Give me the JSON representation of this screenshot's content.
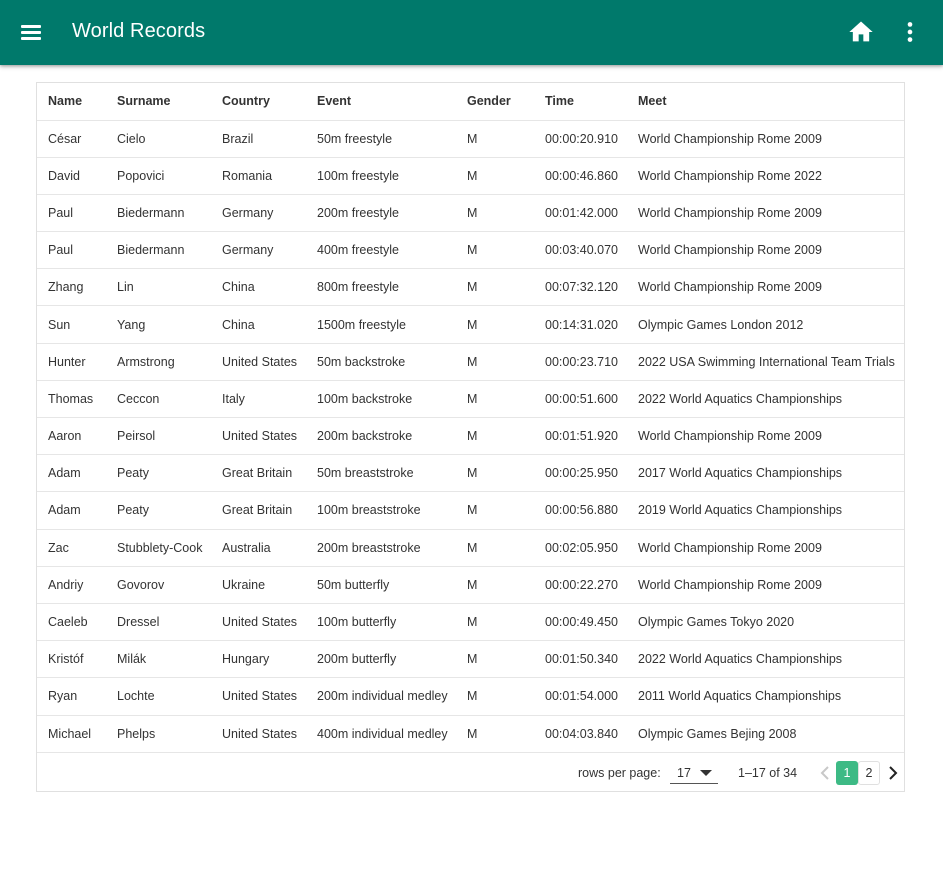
{
  "appbar": {
    "title": "World Records",
    "menu_icon": "menu-icon",
    "home_icon": "home-icon",
    "more_icon": "more-vert-icon",
    "background_color": "#00796b"
  },
  "table": {
    "headers": [
      "Name",
      "Surname",
      "Country",
      "Event",
      "Gender",
      "Time",
      "Meet"
    ],
    "rows": [
      [
        "César",
        "Cielo",
        "Brazil",
        "50m freestyle",
        "M",
        "00:00:20.910",
        "World Championship Rome 2009"
      ],
      [
        "David",
        "Popovici",
        "Romania",
        "100m freestyle",
        "M",
        "00:00:46.860",
        "World Championship Rome 2022"
      ],
      [
        "Paul",
        "Biedermann",
        "Germany",
        "200m freestyle",
        "M",
        "00:01:42.000",
        "World Championship Rome 2009"
      ],
      [
        "Paul",
        "Biedermann",
        "Germany",
        "400m freestyle",
        "M",
        "00:03:40.070",
        "World Championship Rome 2009"
      ],
      [
        "Zhang",
        "Lin",
        "China",
        "800m freestyle",
        "M",
        "00:07:32.120",
        "World Championship Rome 2009"
      ],
      [
        "Sun",
        "Yang",
        "China",
        "1500m freestyle",
        "M",
        "00:14:31.020",
        "Olympic Games London 2012"
      ],
      [
        "Hunter",
        "Armstrong",
        "United States",
        "50m backstroke",
        "M",
        "00:00:23.710",
        "2022 USA Swimming International Team Trials"
      ],
      [
        "Thomas",
        "Ceccon",
        "Italy",
        "100m backstroke",
        "M",
        "00:00:51.600",
        "2022 World Aquatics Championships"
      ],
      [
        "Aaron",
        "Peirsol",
        "United States",
        "200m backstroke",
        "M",
        "00:01:51.920",
        "World Championship Rome 2009"
      ],
      [
        "Adam",
        "Peaty",
        "Great Britain",
        "50m breaststroke",
        "M",
        "00:00:25.950",
        "2017 World Aquatics Championships"
      ],
      [
        "Adam",
        "Peaty",
        "Great Britain",
        "100m breaststroke",
        "M",
        "00:00:56.880",
        "2019 World Aquatics Championships"
      ],
      [
        "Zac",
        "Stubblety-Cook",
        "Australia",
        "200m breaststroke",
        "M",
        "00:02:05.950",
        "World Championship Rome 2009"
      ],
      [
        "Andriy",
        "Govorov",
        "Ukraine",
        "50m butterfly",
        "M",
        "00:00:22.270",
        "World Championship Rome 2009"
      ],
      [
        "Caeleb",
        "Dressel",
        "United States",
        "100m butterfly",
        "M",
        "00:00:49.450",
        "Olympic Games Tokyo 2020"
      ],
      [
        "Kristóf",
        "Milák",
        "Hungary",
        "200m butterfly",
        "M",
        "00:01:50.340",
        "2022 World Aquatics Championships"
      ],
      [
        "Ryan",
        "Lochte",
        "United States",
        "200m individual medley",
        "M",
        "00:01:54.000",
        "2011 World Aquatics Championships"
      ],
      [
        "Michael",
        "Phelps",
        "United States",
        "400m individual medley",
        "M",
        "00:04:03.840",
        "Olympic Games Bejing 2008"
      ]
    ]
  },
  "pagination": {
    "rows_per_page_label": "rows per page:",
    "rows_per_page_value": "17",
    "range_text": "1–17 of 34",
    "pages": [
      "1",
      "2"
    ],
    "active_page": "1",
    "active_color": "#3dba85",
    "prev_icon": "chevron-left-icon",
    "next_icon": "chevron-right-icon"
  }
}
